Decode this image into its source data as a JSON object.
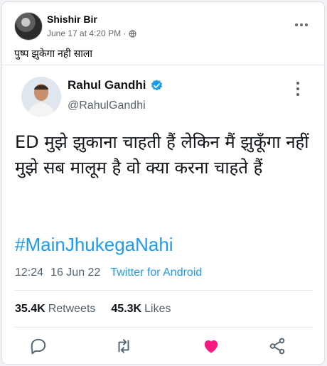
{
  "post": {
    "author": "Shishir Bir",
    "time": "June 17 at 4:20 PM ·",
    "text": "पुष्प झुकेगा नही साला"
  },
  "tweet": {
    "name": "Rahul Gandhi",
    "handle": "@RahulGandhi",
    "text": "ED मुझे झुकाना चाहती हैं लेकिन मैं झुकूँगा नहीं मुझे सब मालूम है वो क्या करना चाहते हैं",
    "hashtag": "#MainJhukegaNahi",
    "time": "12:24",
    "date": "16 Jun 22",
    "source": "Twitter for Android",
    "retweets_count": "35.4K",
    "retweets_label": "Retweets",
    "likes_count": "45.3K",
    "likes_label": "Likes"
  },
  "icons": {
    "avatar": "avatar",
    "globe": "globe-icon",
    "more": "more-horizontal-icon",
    "verified": "verified-badge-icon",
    "reply": "reply-icon",
    "retweet": "retweet-icon",
    "like": "heart-icon",
    "share": "share-icon"
  },
  "colors": {
    "link": "#1d9bf0",
    "like": "#f91880",
    "muted": "#536471"
  }
}
